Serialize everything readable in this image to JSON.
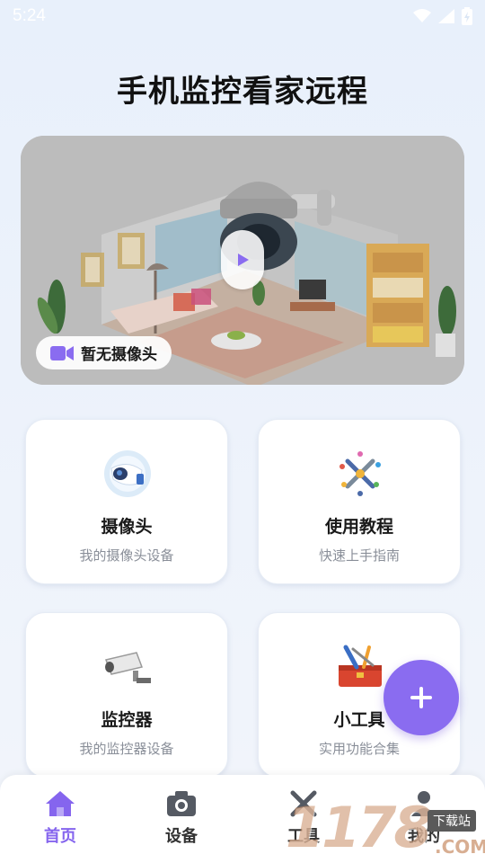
{
  "status_bar": {
    "time": "5:24"
  },
  "app_title": "手机监控看家远程",
  "banner": {
    "camera_status": "暂无摄像头"
  },
  "cards": [
    {
      "title": "摄像头",
      "subtitle": "我的摄像头设备",
      "icon": "security-camera-icon"
    },
    {
      "title": "使用教程",
      "subtitle": "快速上手指南",
      "icon": "tools-tutorial-icon"
    },
    {
      "title": "监控器",
      "subtitle": "我的监控器设备",
      "icon": "cctv-monitor-icon"
    },
    {
      "title": "小工具",
      "subtitle": "实用功能合集",
      "icon": "toolbox-icon"
    }
  ],
  "fab": {
    "icon": "plus-icon"
  },
  "tabs": [
    {
      "label": "首页",
      "icon": "home-icon",
      "active": true
    },
    {
      "label": "设备",
      "icon": "camera-icon",
      "active": false
    },
    {
      "label": "工具",
      "icon": "tools-icon",
      "active": false
    },
    {
      "label": "我的",
      "icon": "user-icon",
      "active": false
    }
  ],
  "watermark": {
    "text": "1178",
    "tag": "下载站",
    "suffix": ".COM"
  },
  "colors": {
    "accent": "#8565ee",
    "fab": "#8a6cf0",
    "background": "#eaf1fb"
  }
}
